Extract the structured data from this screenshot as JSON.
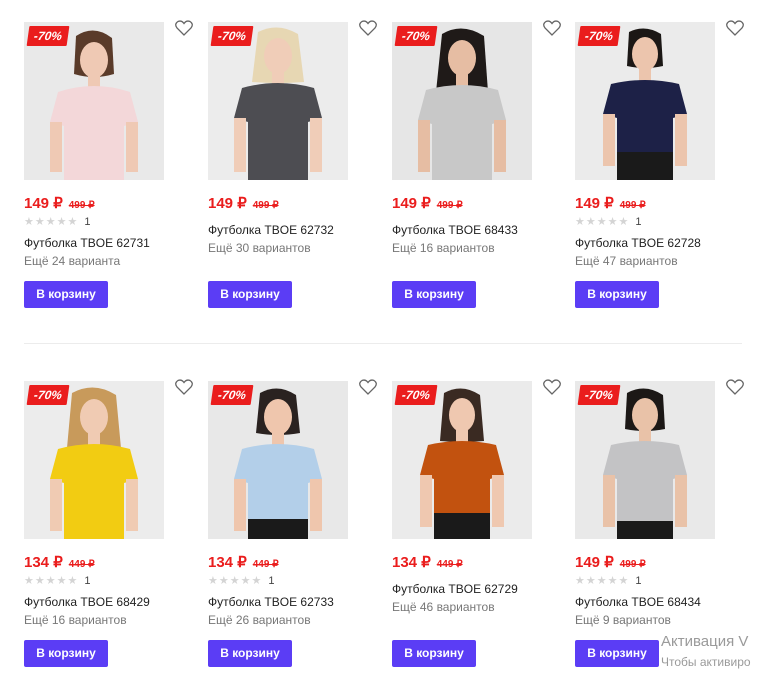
{
  "cart_label": "В корзину",
  "sale_label": "-70%",
  "accent_color": "#5b3df5",
  "sale_color": "#ea1d1d",
  "products": [
    {
      "price": "149 ₽",
      "old_price": "499 ₽",
      "rating_count": "1",
      "title": "Футболка TBOE 62731",
      "variants": "Ещё 24 варианта",
      "shirt_color": "#f3d7d9"
    },
    {
      "price": "149 ₽",
      "old_price": "499 ₽",
      "rating_count": "",
      "title": "Футболка TBOE 62732",
      "variants": "Ещё 30 вариантов",
      "shirt_color": "#4d4d52"
    },
    {
      "price": "149 ₽",
      "old_price": "499 ₽",
      "rating_count": "",
      "title": "Футболка TBOE 68433",
      "variants": "Ещё 16 вариантов",
      "shirt_color": "#c8c8c8"
    },
    {
      "price": "149 ₽",
      "old_price": "499 ₽",
      "rating_count": "1",
      "title": "Футболка TBOE 62728",
      "variants": "Ещё 47 вариантов",
      "shirt_color": "#1d2147"
    },
    {
      "price": "134 ₽",
      "old_price": "449 ₽",
      "rating_count": "1",
      "title": "Футболка TBOE 68429",
      "variants": "Ещё 16 вариантов",
      "shirt_color": "#f2cc12"
    },
    {
      "price": "134 ₽",
      "old_price": "449 ₽",
      "rating_count": "1",
      "title": "Футболка TBOE 62733",
      "variants": "Ещё 26 вариантов",
      "shirt_color": "#b3cfe9"
    },
    {
      "price": "134 ₽",
      "old_price": "449 ₽",
      "rating_count": "",
      "title": "Футболка TBOE 62729",
      "variants": "Ещё 46 вариантов",
      "shirt_color": "#c2520f"
    },
    {
      "price": "149 ₽",
      "old_price": "499 ₽",
      "rating_count": "1",
      "title": "Футболка TBOE 68434",
      "variants": "Ещё 9 вариантов",
      "shirt_color": "#c3c3c5"
    }
  ],
  "watermark": {
    "line1": "Активация V",
    "line2": "Чтобы активиро"
  }
}
